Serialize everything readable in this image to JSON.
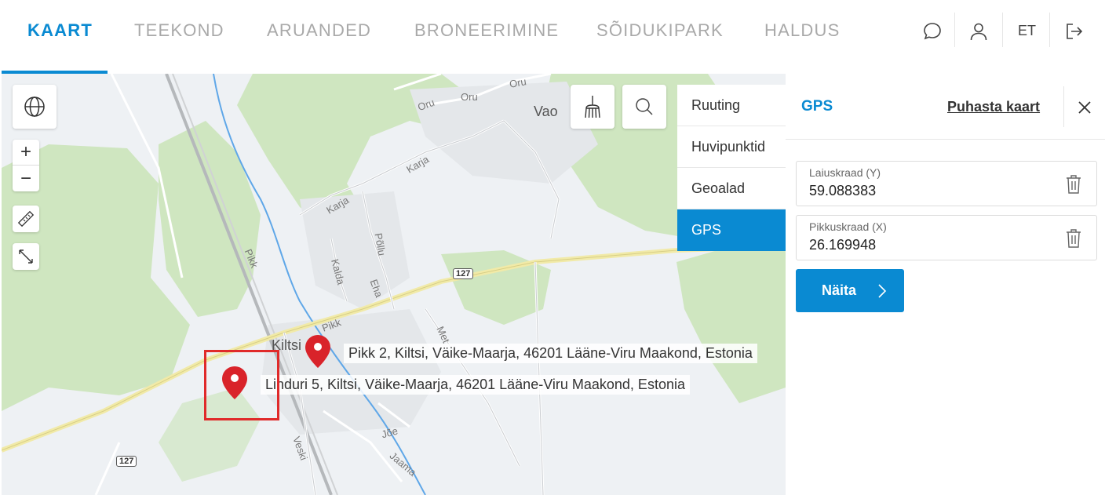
{
  "nav": {
    "tabs": [
      {
        "label": "KAART"
      },
      {
        "label": "TEEKOND"
      },
      {
        "label": "ARUANDED"
      },
      {
        "label": "BRONEERIMINE"
      },
      {
        "label": "SÕIDUKIPARK"
      },
      {
        "label": "HALDUS"
      }
    ],
    "active_tab": "KAART",
    "language": "ET",
    "icons": [
      "chat-icon",
      "user-icon",
      "logout-icon"
    ]
  },
  "map": {
    "place_labels": {
      "vao": "Vao",
      "kiltsi": "Kiltsi",
      "oru1": "Oru",
      "oru2": "Oru",
      "oru3": "Oru",
      "karja1": "Karja",
      "karja2": "Karja",
      "pollu": "Põllu",
      "kalda": "Kalda",
      "eha": "Eha",
      "pikk1": "Pikk",
      "pikk2": "Pikk",
      "joe": "Jõe",
      "jaama": "Jaama",
      "veski": "Veski",
      "met": "Met"
    },
    "road_shields": {
      "a": "127",
      "b": "127"
    },
    "markers": [
      {
        "address": "Pikk 2, Kiltsi, Väike-Maarja, 46201 Lääne-Viru Maakond, Estonia"
      },
      {
        "address": "Linduri 5, Kiltsi, Väike-Maarja, 46201 Lääne-Viru Maakond, Estonia"
      }
    ],
    "controls": {
      "zoom_in": "+",
      "zoom_out": "−"
    }
  },
  "side_menu": {
    "items": [
      {
        "label": "Ruuting"
      },
      {
        "label": "Huvipunktid"
      },
      {
        "label": "Geoalad"
      },
      {
        "label": "GPS"
      }
    ],
    "active": "GPS"
  },
  "panel": {
    "title": "GPS",
    "clear_label": "Puhasta kaart",
    "latitude": {
      "label": "Laiuskraad (Y)",
      "value": "59.088383"
    },
    "longitude": {
      "label": "Pikkuskraad (X)",
      "value": "26.169948"
    },
    "show_button": "Näita"
  },
  "colors": {
    "accent": "#0a8ad2",
    "marker": "#d9232a",
    "forest": "#cfe6c0"
  }
}
